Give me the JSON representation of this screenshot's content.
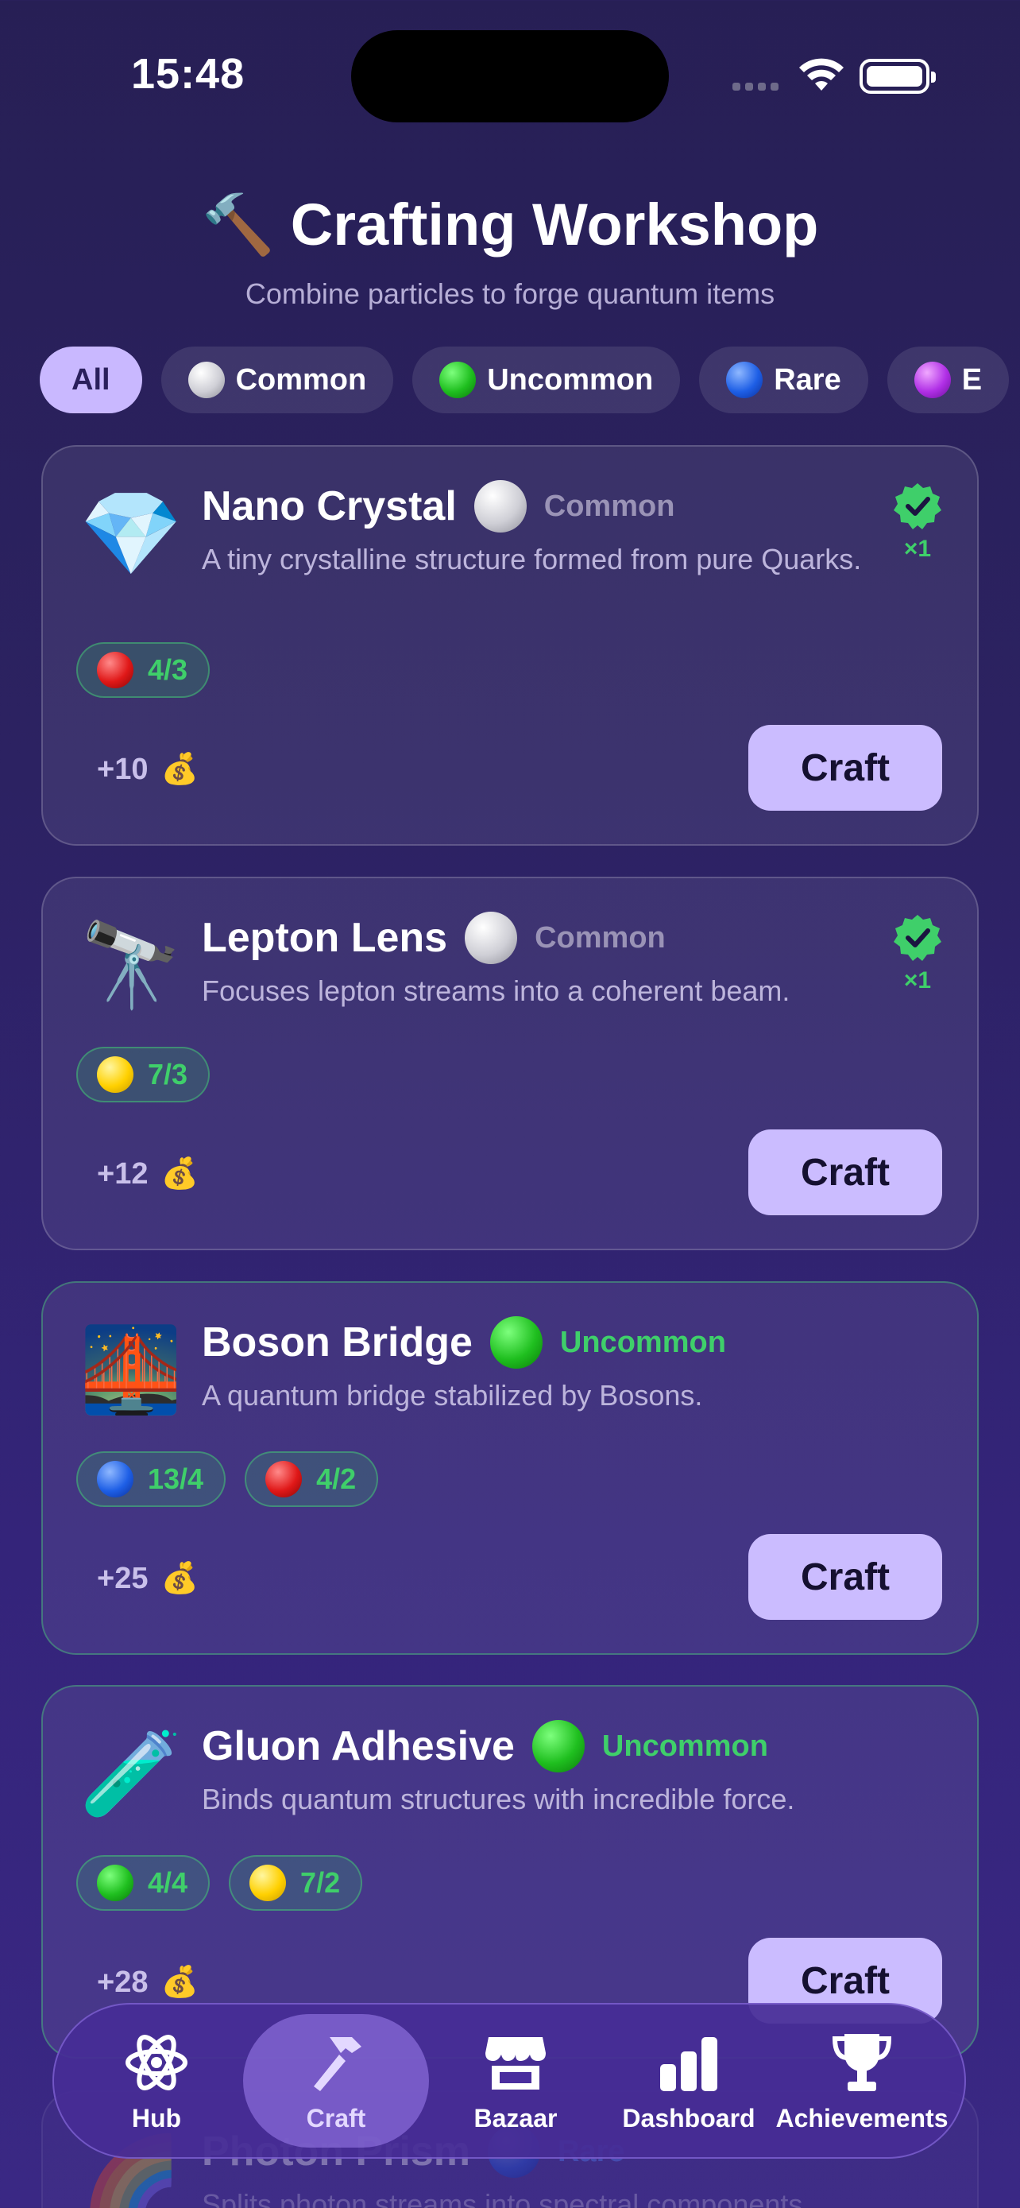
{
  "status": {
    "time": "15:48"
  },
  "header": {
    "icon": "🔨",
    "title": "Crafting Workshop",
    "subtitle": "Combine particles to forge quantum items"
  },
  "filters": [
    {
      "label": "All",
      "active": true
    },
    {
      "label": "Common",
      "dot": "common"
    },
    {
      "label": "Uncommon",
      "dot": "uncommon"
    },
    {
      "label": "Rare",
      "dot": "rare"
    },
    {
      "label": "E",
      "dot": "epic"
    }
  ],
  "items": [
    {
      "icon": "💎",
      "icon_name": "gem-icon",
      "name": "Nano Crystal",
      "rarity": "Common",
      "description": "A tiny crystalline structure formed from pure Quarks.",
      "owned": "×1",
      "requirements": [
        {
          "dot": "red",
          "text": "4/3"
        }
      ],
      "reward": "+10",
      "reward_icon": "💰",
      "action": "Craft"
    },
    {
      "icon": "🔭",
      "icon_name": "telescope-icon",
      "name": "Lepton Lens",
      "rarity": "Common",
      "description": "Focuses lepton streams into a coherent beam.",
      "owned": "×1",
      "requirements": [
        {
          "dot": "yellow",
          "text": "7/3"
        }
      ],
      "reward": "+12",
      "reward_icon": "💰",
      "action": "Craft"
    },
    {
      "icon": "🌉",
      "icon_name": "bridge-icon",
      "name": "Boson Bridge",
      "rarity": "Uncommon",
      "description": "A quantum bridge stabilized by Bosons.",
      "requirements": [
        {
          "dot": "rare",
          "text": "13/4"
        },
        {
          "dot": "red",
          "text": "4/2"
        }
      ],
      "reward": "+25",
      "reward_icon": "💰",
      "action": "Craft"
    },
    {
      "icon": "🧪",
      "icon_name": "test-tube-icon",
      "name": "Gluon Adhesive",
      "rarity": "Uncommon",
      "description": "Binds quantum structures with incredible force.",
      "requirements": [
        {
          "dot": "uncommon",
          "text": "4/4"
        },
        {
          "dot": "yellow",
          "text": "7/2"
        }
      ],
      "reward": "+28",
      "reward_icon": "💰",
      "action": "Craft"
    },
    {
      "icon": "🌈",
      "icon_name": "rainbow-icon",
      "name": "Photon Prism",
      "rarity": "Rare",
      "description": "Splits photon streams into spectral components"
    }
  ],
  "tabs": [
    {
      "label": "Hub",
      "icon": "atom-icon"
    },
    {
      "label": "Craft",
      "icon": "hammer-icon",
      "active": true
    },
    {
      "label": "Bazaar",
      "icon": "storefront-icon"
    },
    {
      "label": "Dashboard",
      "icon": "bar-chart-icon"
    },
    {
      "label": "Achievements",
      "icon": "trophy-icon"
    }
  ],
  "colors": {
    "accent": "#cbbcff",
    "owned_green": "#3fcf6a",
    "background": "#2c2262"
  }
}
